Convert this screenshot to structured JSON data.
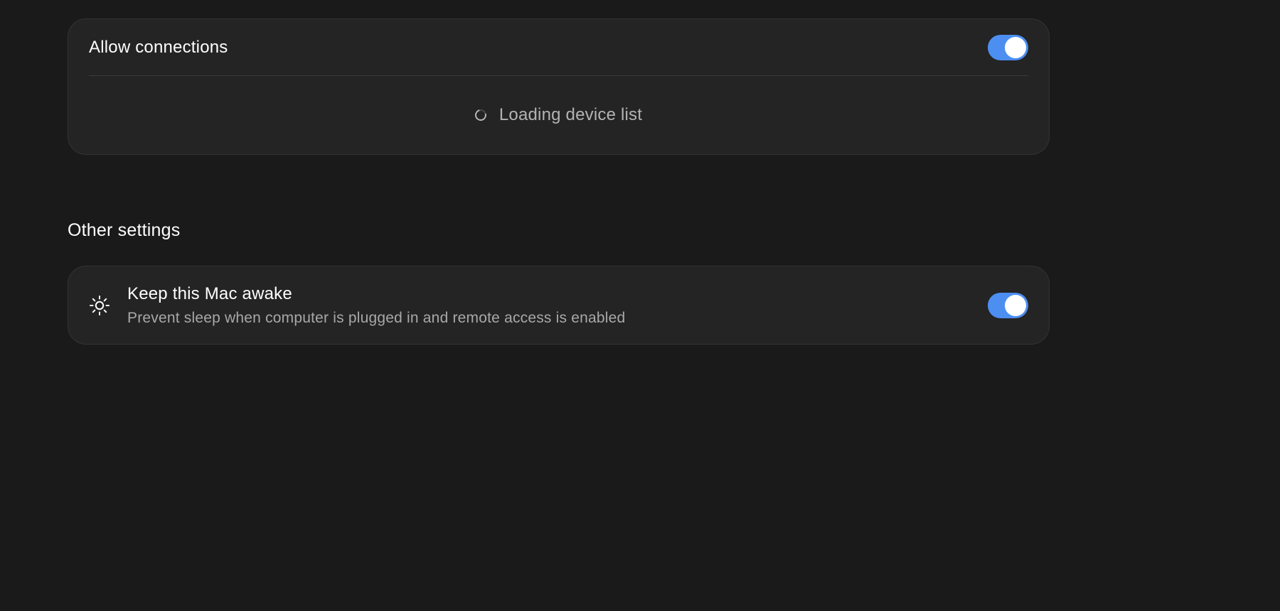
{
  "connections": {
    "allow_label": "Allow connections",
    "allow_enabled": true,
    "loading_text": "Loading device list"
  },
  "other_settings": {
    "title": "Other settings",
    "keep_awake": {
      "title": "Keep this Mac awake",
      "description": "Prevent sleep when computer is plugged in and remote access is enabled",
      "enabled": true,
      "icon": "sun-icon"
    }
  },
  "colors": {
    "background": "#1a1a1a",
    "card": "#242424",
    "toggle_on": "#4d8ff1",
    "secondary_text": "#b3b3b3"
  }
}
